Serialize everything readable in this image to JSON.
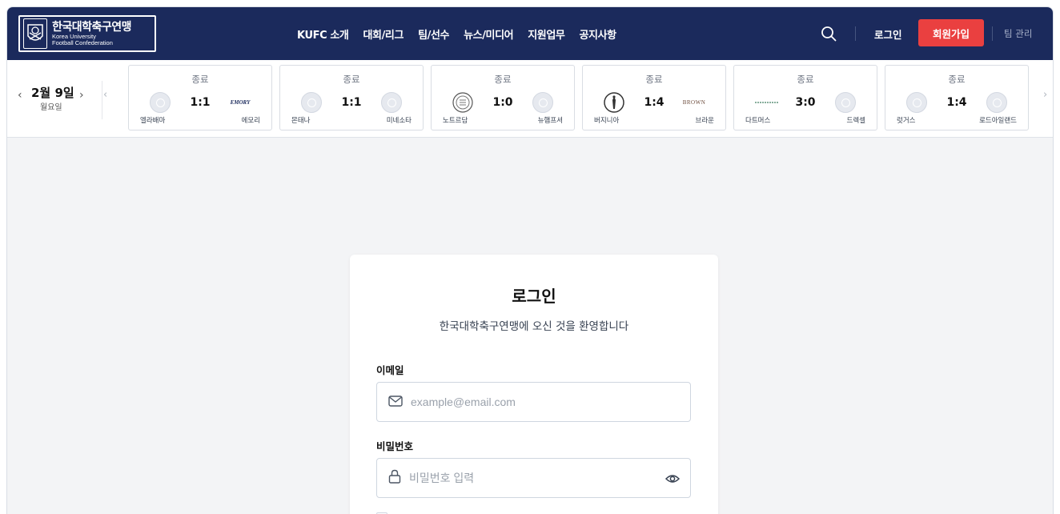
{
  "brand": {
    "name_ko": "한국대학축구연맹",
    "name_en_line1": "Korea University",
    "name_en_line2": "Football Confederation"
  },
  "nav": {
    "items": [
      "KUFC 소개",
      "대회/리그",
      "팀/선수",
      "뉴스/미디어",
      "지원업무",
      "공지사항"
    ],
    "login": "로그인",
    "signup": "회원가입",
    "team_mgmt": "팀 관리"
  },
  "date_nav": {
    "date": "2월 9일",
    "weekday": "월요일"
  },
  "games": [
    {
      "status": "종료",
      "score": "1:1",
      "home": "엘라배마",
      "away": "에모리",
      "away_logo_text": "EMORY"
    },
    {
      "status": "종료",
      "score": "1:1",
      "home": "몬태나",
      "away": "미네소타"
    },
    {
      "status": "종료",
      "score": "1:0",
      "home": "노트르담",
      "away": "뉴햄프셔"
    },
    {
      "status": "종료",
      "score": "1:4",
      "home": "버지니아",
      "away": "브라운",
      "away_logo_text": "BROWN"
    },
    {
      "status": "종료",
      "score": "3:0",
      "home": "다트머스",
      "away": "드렉셀"
    },
    {
      "status": "종료",
      "score": "1:4",
      "home": "럿거스",
      "away": "로드아일랜드"
    }
  ],
  "login": {
    "title": "로그인",
    "subtitle": "한국대학축구연맹에 오신 것을 환영합니다",
    "email_label": "이메일",
    "email_placeholder": "example@email.com",
    "password_label": "비밀번호",
    "password_placeholder": "비밀번호 입력"
  },
  "colors": {
    "header_bg": "#1b2a5c",
    "signup_bg": "#ea4040",
    "page_bg": "#f3f4f6"
  }
}
